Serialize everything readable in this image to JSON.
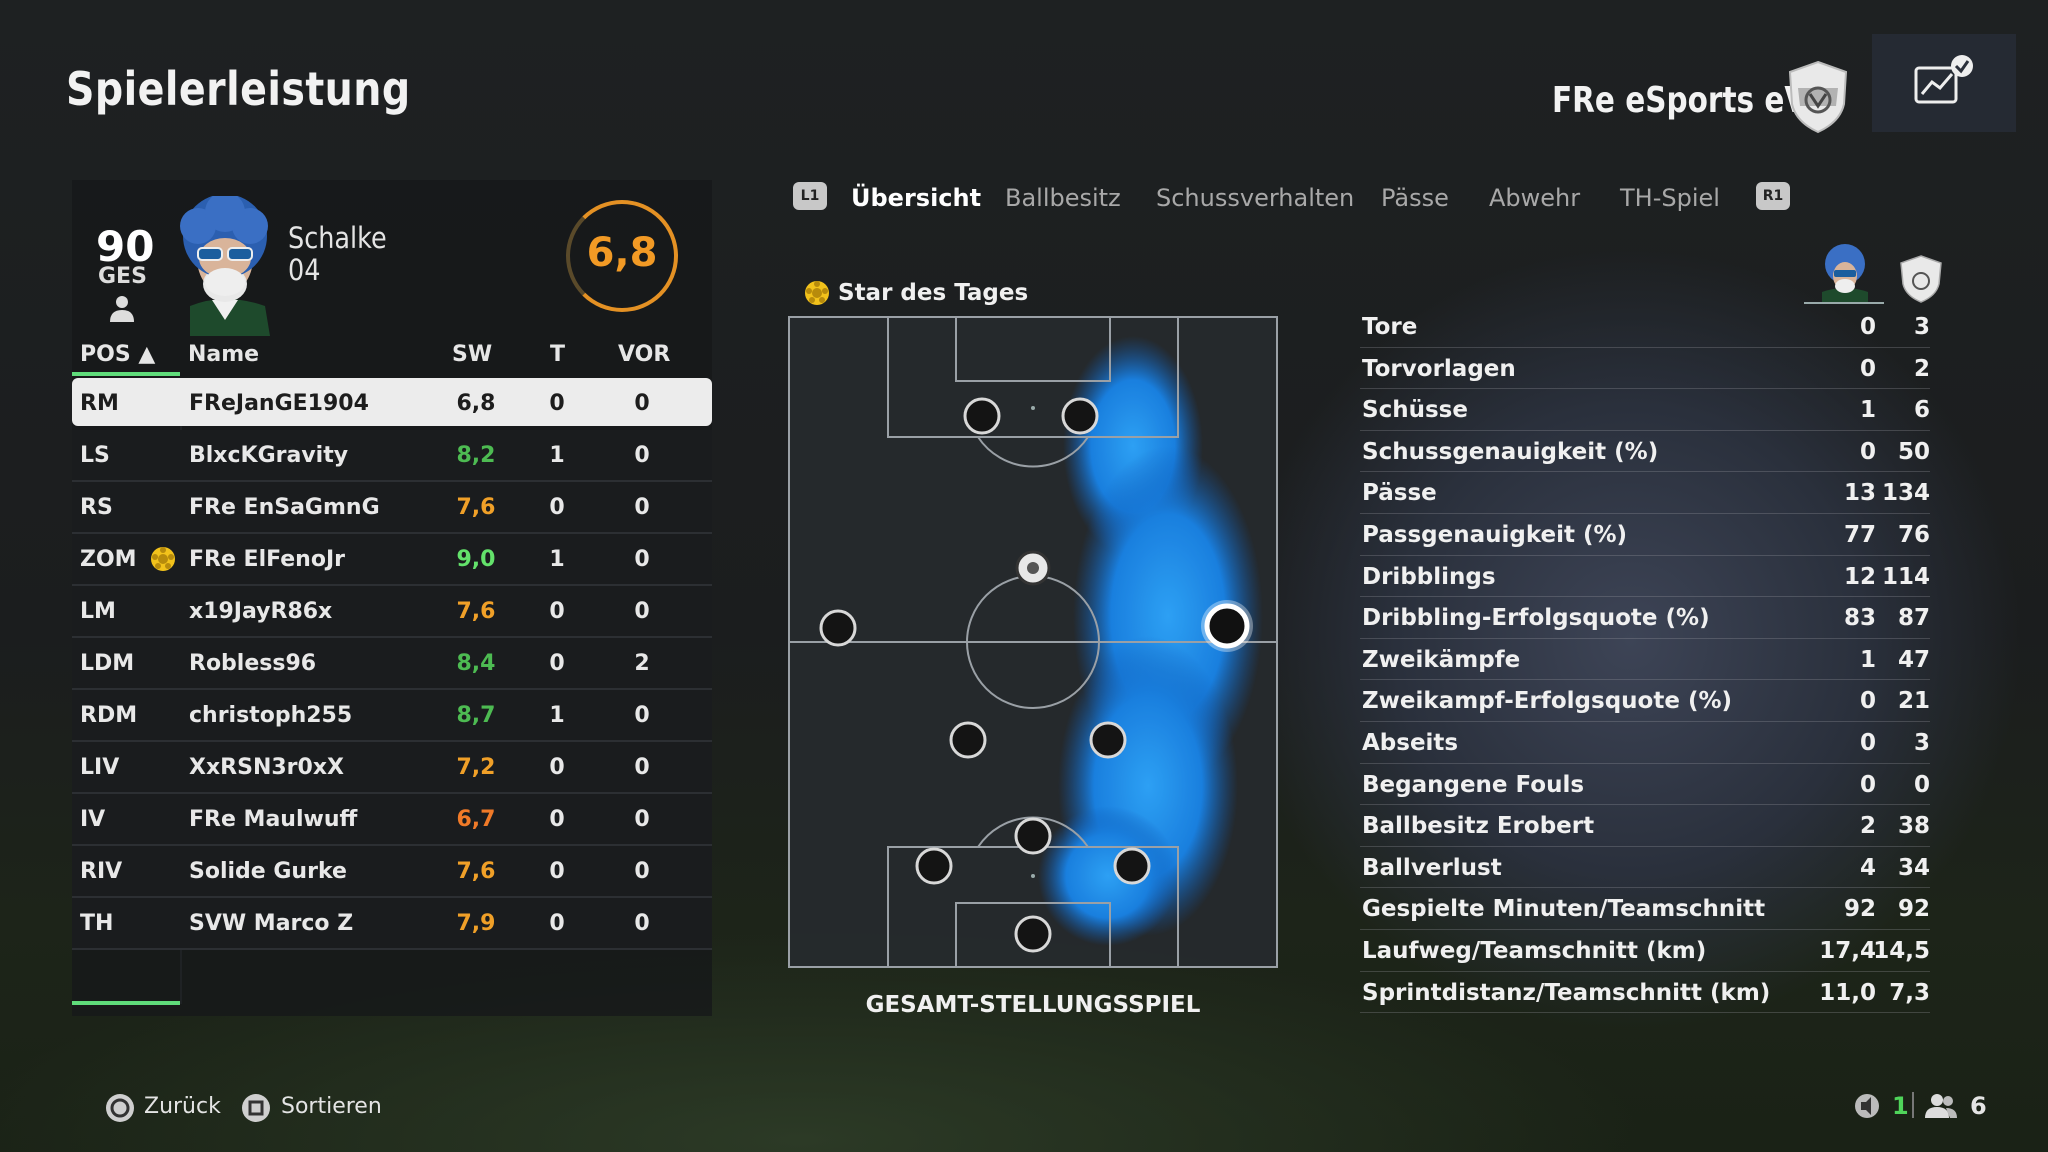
{
  "header": {
    "title": "Spielerleistung",
    "club_name": "FRe eSports eV",
    "crest_icon": "club-crest-icon",
    "perf_icon": "performance-chart-check-icon"
  },
  "player_card": {
    "overall": "90",
    "overall_label": "GES",
    "club_line1": "Schalke",
    "club_line2": "04",
    "match_rating": "6,8",
    "rating_color": "#f29a25"
  },
  "table": {
    "headers": {
      "pos": "POS ▲",
      "name": "Name",
      "sw": "SW",
      "t": "T",
      "vor": "VOR"
    },
    "rows": [
      {
        "pos": "RM",
        "name": "FReJanGE1904",
        "sw": "6,8",
        "t": "0",
        "vor": "0",
        "color": "#1d1d1d",
        "selected": true,
        "star": false
      },
      {
        "pos": "LS",
        "name": "BlxcKGravity",
        "sw": "8,2",
        "t": "1",
        "vor": "0",
        "color": "#4dbb52",
        "selected": false,
        "star": false
      },
      {
        "pos": "RS",
        "name": "FRe EnSaGmnG",
        "sw": "7,6",
        "t": "0",
        "vor": "0",
        "color": "#f0a028",
        "selected": false,
        "star": false
      },
      {
        "pos": "ZOM",
        "name": "FRe ElFenoJr",
        "sw": "9,0",
        "t": "1",
        "vor": "0",
        "color": "#63e26b",
        "selected": false,
        "star": true
      },
      {
        "pos": "LM",
        "name": "x19JayR86x",
        "sw": "7,6",
        "t": "0",
        "vor": "0",
        "color": "#f0a028",
        "selected": false,
        "star": false
      },
      {
        "pos": "LDM",
        "name": "Robless96",
        "sw": "8,4",
        "t": "0",
        "vor": "2",
        "color": "#4dbb52",
        "selected": false,
        "star": false
      },
      {
        "pos": "RDM",
        "name": "christoph255",
        "sw": "8,7",
        "t": "1",
        "vor": "0",
        "color": "#4dbb52",
        "selected": false,
        "star": false
      },
      {
        "pos": "LIV",
        "name": "XxRSN3r0xX",
        "sw": "7,2",
        "t": "0",
        "vor": "0",
        "color": "#f0a028",
        "selected": false,
        "star": false
      },
      {
        "pos": "IV",
        "name": "FRe Maulwuff",
        "sw": "6,7",
        "t": "0",
        "vor": "0",
        "color": "#f07a28",
        "selected": false,
        "star": false
      },
      {
        "pos": "RIV",
        "name": "Solide Gurke",
        "sw": "7,6",
        "t": "0",
        "vor": "0",
        "color": "#f0a028",
        "selected": false,
        "star": false
      },
      {
        "pos": "TH",
        "name": "SVW Marco Z",
        "sw": "7,9",
        "t": "0",
        "vor": "0",
        "color": "#f0a028",
        "selected": false,
        "star": false
      }
    ]
  },
  "tabs": {
    "l1": "L1",
    "r1": "R1",
    "items": [
      "Übersicht",
      "Ballbesitz",
      "Schussverhalten",
      "Pässe",
      "Abwehr",
      "TH-Spiel"
    ],
    "active_index": 0
  },
  "pitch": {
    "star_label": "Star des Tages",
    "label": "GESAMT-STELLUNGSSPIEL",
    "heat_color": "#1e90ff"
  },
  "stats": {
    "rows": [
      {
        "label": "Tore",
        "player": "0",
        "team": "3"
      },
      {
        "label": "Torvorlagen",
        "player": "0",
        "team": "2"
      },
      {
        "label": "Schüsse",
        "player": "1",
        "team": "6"
      },
      {
        "label": "Schussgenauigkeit (%)",
        "player": "0",
        "team": "50"
      },
      {
        "label": "Pässe",
        "player": "13",
        "team": "134"
      },
      {
        "label": "Passgenauigkeit (%)",
        "player": "77",
        "team": "76"
      },
      {
        "label": "Dribblings",
        "player": "12",
        "team": "114"
      },
      {
        "label": "Dribbling-Erfolgsquote (%)",
        "player": "83",
        "team": "87"
      },
      {
        "label": "Zweikämpfe",
        "player": "1",
        "team": "47"
      },
      {
        "label": "Zweikampf-Erfolgsquote (%)",
        "player": "0",
        "team": "21"
      },
      {
        "label": "Abseits",
        "player": "0",
        "team": "3"
      },
      {
        "label": "Begangene Fouls",
        "player": "0",
        "team": "0"
      },
      {
        "label": "Ballbesitz Erobert",
        "player": "2",
        "team": "38"
      },
      {
        "label": "Ballverlust",
        "player": "4",
        "team": "34"
      },
      {
        "label": "Gespielte Minuten/Teamschnitt",
        "player": "92",
        "team": "92"
      },
      {
        "label": "Laufweg/Teamschnitt (km)",
        "player": "17,4",
        "team": "14,5"
      },
      {
        "label": "Sprintdistanz/Teamschnitt (km)",
        "player": "11,0",
        "team": "7,3"
      }
    ]
  },
  "footer": {
    "back": "Zurück",
    "sort": "Sortieren",
    "speaker_count": "1",
    "players_count": "6",
    "back_icon": "circle-button-icon",
    "sort_icon": "square-button-icon"
  }
}
